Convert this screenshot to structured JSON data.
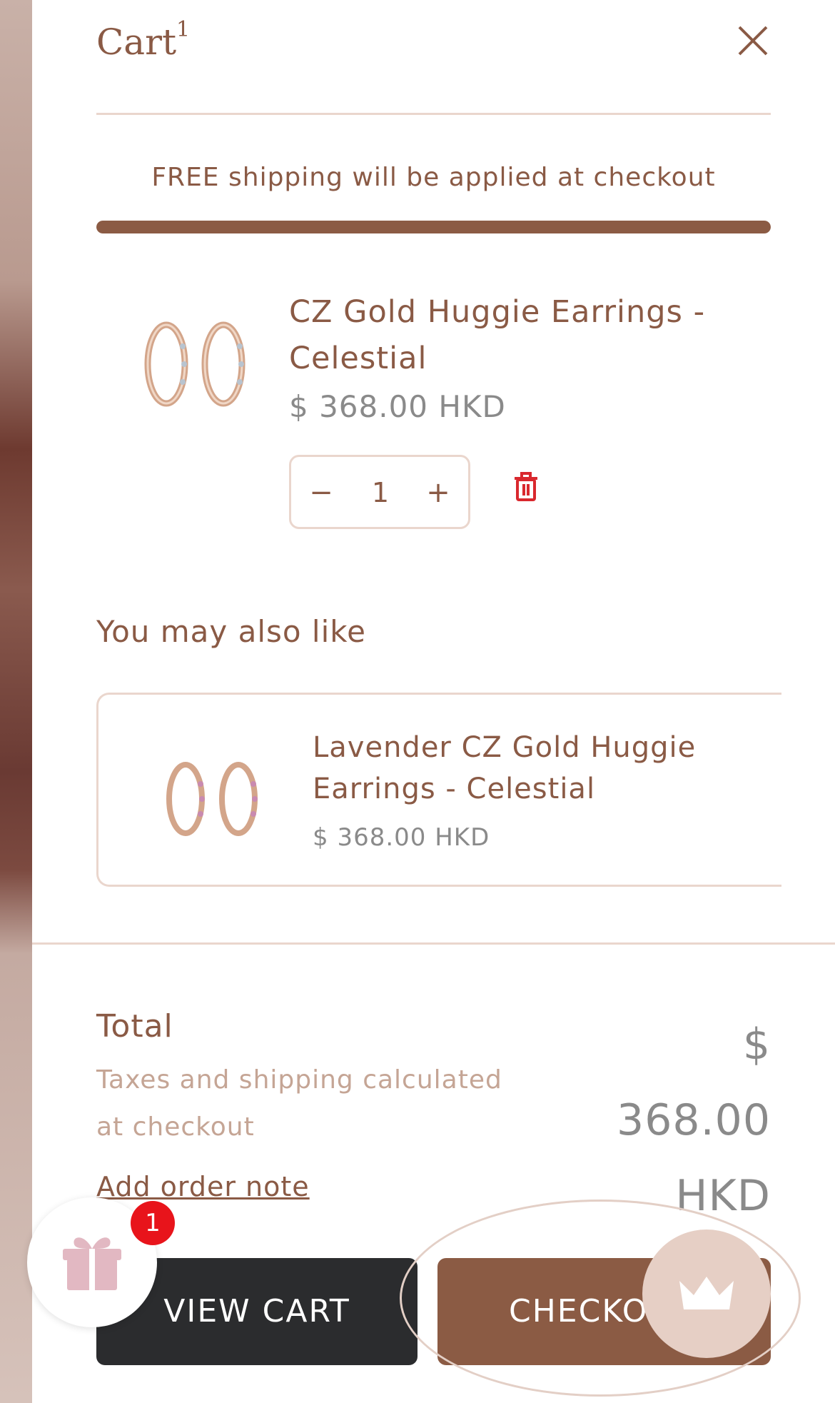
{
  "cart": {
    "title": "Cart",
    "count": "1"
  },
  "shipping": {
    "message": "FREE shipping will be applied at checkout",
    "progress_percent": 100
  },
  "item": {
    "name": "CZ Gold Huggie Earrings - Celestial",
    "price": "$ 368.00 HKD",
    "quantity": "1",
    "minus": "−",
    "plus": "+"
  },
  "recommendations": {
    "title": "You may also like",
    "items": [
      {
        "name": "Lavender CZ Gold Huggie Earrings - Celestial",
        "price": "$ 368.00 HKD"
      }
    ]
  },
  "summary": {
    "total_label": "Total",
    "tax_note": "Taxes and shipping calculated at checkout",
    "total_value": "$ 368.00 HKD",
    "add_note": "Add order note"
  },
  "actions": {
    "view_cart": "VIEW CART",
    "checkout": "CHECKOUT"
  },
  "gift": {
    "badge": "1"
  },
  "colors": {
    "brand": "#8b5b44",
    "accent_light": "#ead6cd",
    "dark_button": "#2b2c2e",
    "badge": "#e8141b"
  },
  "icons": {
    "close": "close-icon",
    "trash": "trash-icon",
    "gift": "gift-icon",
    "crown": "crown-icon"
  }
}
